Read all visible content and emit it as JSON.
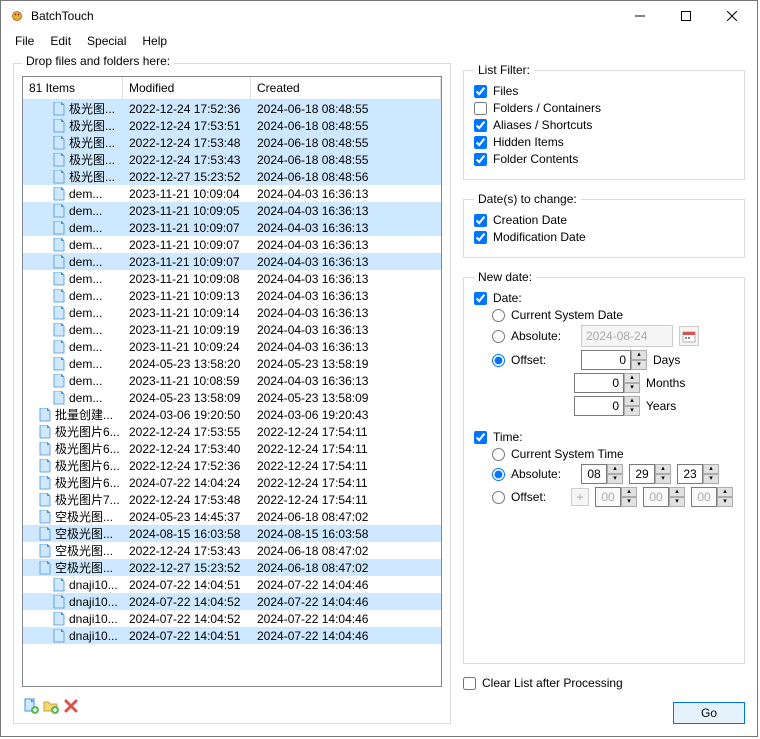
{
  "title": "BatchTouch",
  "menu": {
    "file": "File",
    "edit": "Edit",
    "special": "Special",
    "help": "Help"
  },
  "drop_label": "Drop files and folders here:",
  "columns": {
    "count": "81 Items",
    "modified": "Modified",
    "created": "Created"
  },
  "files": [
    {
      "indent": 2,
      "sel": true,
      "name": "极光图...",
      "mod": "2022-12-24 17:52:36",
      "cre": "2024-06-18 08:48:55"
    },
    {
      "indent": 2,
      "sel": true,
      "name": "极光图...",
      "mod": "2022-12-24 17:53:51",
      "cre": "2024-06-18 08:48:55"
    },
    {
      "indent": 2,
      "sel": true,
      "name": "极光图...",
      "mod": "2022-12-24 17:53:48",
      "cre": "2024-06-18 08:48:55"
    },
    {
      "indent": 2,
      "sel": true,
      "name": "极光图...",
      "mod": "2022-12-24 17:53:43",
      "cre": "2024-06-18 08:48:55"
    },
    {
      "indent": 2,
      "sel": true,
      "name": "极光图...",
      "mod": "2022-12-27 15:23:52",
      "cre": "2024-06-18 08:48:56"
    },
    {
      "indent": 2,
      "sel": false,
      "name": "dem...",
      "mod": "2023-11-21 10:09:04",
      "cre": "2024-04-03 16:36:13"
    },
    {
      "indent": 2,
      "sel": true,
      "name": "dem...",
      "mod": "2023-11-21 10:09:05",
      "cre": "2024-04-03 16:36:13"
    },
    {
      "indent": 2,
      "sel": true,
      "name": "dem...",
      "mod": "2023-11-21 10:09:07",
      "cre": "2024-04-03 16:36:13"
    },
    {
      "indent": 2,
      "sel": false,
      "name": "dem...",
      "mod": "2023-11-21 10:09:07",
      "cre": "2024-04-03 16:36:13"
    },
    {
      "indent": 2,
      "sel": true,
      "name": "dem...",
      "mod": "2023-11-21 10:09:07",
      "cre": "2024-04-03 16:36:13"
    },
    {
      "indent": 2,
      "sel": false,
      "name": "dem...",
      "mod": "2023-11-21 10:09:08",
      "cre": "2024-04-03 16:36:13"
    },
    {
      "indent": 2,
      "sel": false,
      "name": "dem...",
      "mod": "2023-11-21 10:09:13",
      "cre": "2024-04-03 16:36:13"
    },
    {
      "indent": 2,
      "sel": false,
      "name": "dem...",
      "mod": "2023-11-21 10:09:14",
      "cre": "2024-04-03 16:36:13"
    },
    {
      "indent": 2,
      "sel": false,
      "name": "dem...",
      "mod": "2023-11-21 10:09:19",
      "cre": "2024-04-03 16:36:13"
    },
    {
      "indent": 2,
      "sel": false,
      "name": "dem...",
      "mod": "2023-11-21 10:09:24",
      "cre": "2024-04-03 16:36:13"
    },
    {
      "indent": 2,
      "sel": false,
      "name": "dem...",
      "mod": "2024-05-23 13:58:20",
      "cre": "2024-05-23 13:58:19"
    },
    {
      "indent": 2,
      "sel": false,
      "name": "dem...",
      "mod": "2023-11-21 10:08:59",
      "cre": "2024-04-03 16:36:13"
    },
    {
      "indent": 2,
      "sel": false,
      "name": "dem...",
      "mod": "2024-05-23 13:58:09",
      "cre": "2024-05-23 13:58:09"
    },
    {
      "indent": 1,
      "sel": false,
      "name": "批量创建...",
      "mod": "2024-03-06 19:20:50",
      "cre": "2024-03-06 19:20:43"
    },
    {
      "indent": 1,
      "sel": false,
      "name": "极光图片6...",
      "mod": "2022-12-24 17:53:55",
      "cre": "2022-12-24 17:54:11"
    },
    {
      "indent": 1,
      "sel": false,
      "name": "极光图片6...",
      "mod": "2022-12-24 17:53:40",
      "cre": "2022-12-24 17:54:11"
    },
    {
      "indent": 1,
      "sel": false,
      "name": "极光图片6...",
      "mod": "2022-12-24 17:52:36",
      "cre": "2022-12-24 17:54:11"
    },
    {
      "indent": 1,
      "sel": false,
      "name": "极光图片6...",
      "mod": "2024-07-22 14:04:24",
      "cre": "2022-12-24 17:54:11"
    },
    {
      "indent": 1,
      "sel": false,
      "name": "极光图片7...",
      "mod": "2022-12-24 17:53:48",
      "cre": "2022-12-24 17:54:11"
    },
    {
      "indent": 1,
      "sel": false,
      "name": "空极光图...",
      "mod": "2024-05-23 14:45:37",
      "cre": "2024-06-18 08:47:02"
    },
    {
      "indent": 1,
      "sel": true,
      "name": "空极光图...",
      "mod": "2024-08-15 16:03:58",
      "cre": "2024-08-15 16:03:58"
    },
    {
      "indent": 1,
      "sel": false,
      "name": "空极光图...",
      "mod": "2022-12-24 17:53:43",
      "cre": "2024-06-18 08:47:02"
    },
    {
      "indent": 1,
      "sel": true,
      "name": "空极光图...",
      "mod": "2022-12-27 15:23:52",
      "cre": "2024-06-18 08:47:02"
    },
    {
      "indent": 2,
      "sel": false,
      "name": "dnaji10...",
      "mod": "2024-07-22 14:04:51",
      "cre": "2024-07-22 14:04:46"
    },
    {
      "indent": 2,
      "sel": true,
      "name": "dnaji10...",
      "mod": "2024-07-22 14:04:52",
      "cre": "2024-07-22 14:04:46"
    },
    {
      "indent": 2,
      "sel": false,
      "name": "dnaji10...",
      "mod": "2024-07-22 14:04:52",
      "cre": "2024-07-22 14:04:46"
    },
    {
      "indent": 2,
      "sel": true,
      "name": "dnaji10...",
      "mod": "2024-07-22 14:04:51",
      "cre": "2024-07-22 14:04:46"
    }
  ],
  "filter": {
    "title": "List Filter:",
    "files": "Files",
    "folders": "Folders / Containers",
    "aliases": "Aliases / Shortcuts",
    "hidden": "Hidden Items",
    "contents": "Folder Contents"
  },
  "dates": {
    "title": "Date(s) to change:",
    "creation": "Creation Date",
    "modification": "Modification Date"
  },
  "newdate": {
    "title": "New date:",
    "date": "Date:",
    "current_date": "Current System Date",
    "absolute": "Absolute:",
    "abs_value": "2024-08-24",
    "offset": "Offset:",
    "days_val": "0",
    "months_val": "0",
    "years_val": "0",
    "days": "Days",
    "months": "Months",
    "years": "Years",
    "time": "Time:",
    "current_time": "Current System Time",
    "h": "08",
    "m": "29",
    "s": "23",
    "oh": "00",
    "om": "00",
    "os": "00"
  },
  "clear_list": "Clear List after Processing",
  "go": "Go"
}
